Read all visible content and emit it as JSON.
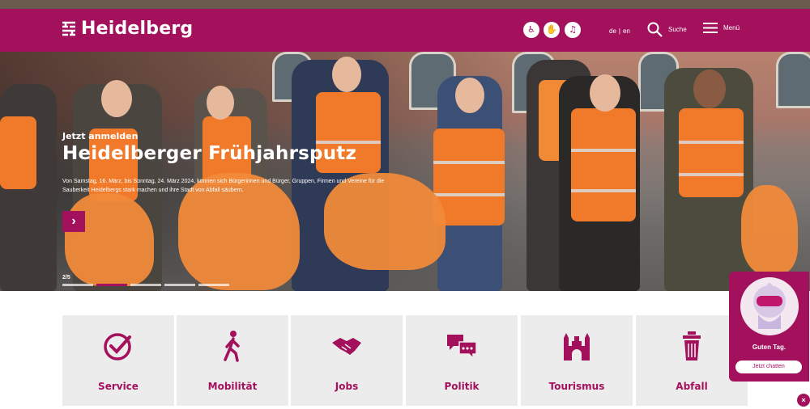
{
  "header": {
    "logo_text": "Heidelberg",
    "a11y_icons": [
      "accessibility-icon",
      "sign-language-icon",
      "audio-icon"
    ],
    "lang_de": "de",
    "lang_separator": "|",
    "lang_en": "en",
    "search_label": "Suche",
    "menu_label": "Menü",
    "brand_color": "#a3115d"
  },
  "hero": {
    "kicker": "Jetzt anmelden",
    "title": "Heidelberger Frühjahrsputz",
    "text": "Von Samstag, 16. März, bis Sonntag, 24. März 2024, können sich Bürgerinnen und Bürger, Gruppen, Firmen und Vereine für die Sauberkeit Heidelbergs stark machen und ihre Stadt von Abfall säubern.",
    "next_glyph": "›",
    "counter": "2/5",
    "slides_total": 5,
    "slide_current": 2
  },
  "tiles": [
    {
      "label": "Service",
      "icon": "check-circle-icon"
    },
    {
      "label": "Mobilität",
      "icon": "walking-person-icon"
    },
    {
      "label": "Jobs",
      "icon": "handshake-icon"
    },
    {
      "label": "Politik",
      "icon": "speech-bubbles-icon"
    },
    {
      "label": "Tourismus",
      "icon": "castle-icon"
    },
    {
      "label": "Abfall",
      "icon": "trash-bin-icon"
    }
  ],
  "chat": {
    "greeting": "Guten Tag.",
    "button_label": "Jetzt chatten",
    "close_glyph": "×"
  }
}
